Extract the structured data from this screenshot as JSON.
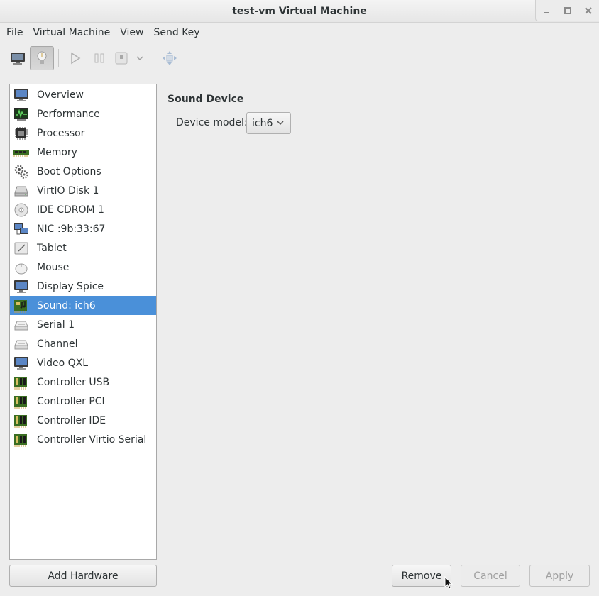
{
  "window": {
    "title": "test-vm Virtual Machine",
    "controls": [
      "minimize-icon",
      "maximize-icon",
      "close-icon"
    ]
  },
  "menubar": {
    "items": [
      "File",
      "Virtual Machine",
      "View",
      "Send Key"
    ]
  },
  "toolbar": {
    "buttons": [
      {
        "name": "console-view",
        "icon": "monitor-icon",
        "active": false
      },
      {
        "name": "details-view",
        "icon": "lightbulb-icon",
        "active": true
      },
      {
        "name": "run",
        "icon": "play-icon",
        "enabled": false
      },
      {
        "name": "pause",
        "icon": "pause-icon",
        "enabled": false
      },
      {
        "name": "shutdown",
        "icon": "power-icon",
        "enabled": false
      },
      {
        "name": "shutdown-menu",
        "icon": "chevron-down-icon",
        "enabled": false
      },
      {
        "name": "fullscreen",
        "icon": "fullscreen-icon",
        "enabled": false
      }
    ]
  },
  "hardware_list": {
    "items": [
      {
        "label": "Overview",
        "icon": "monitor-icon"
      },
      {
        "label": "Performance",
        "icon": "performance-monitor-icon"
      },
      {
        "label": "Processor",
        "icon": "cpu-chip-icon"
      },
      {
        "label": "Memory",
        "icon": "memory-module-icon"
      },
      {
        "label": "Boot Options",
        "icon": "gears-icon"
      },
      {
        "label": "VirtIO Disk 1",
        "icon": "hard-disk-icon"
      },
      {
        "label": "IDE CDROM 1",
        "icon": "cdrom-icon"
      },
      {
        "label": "NIC :9b:33:67",
        "icon": "network-icon"
      },
      {
        "label": "Tablet",
        "icon": "tablet-icon"
      },
      {
        "label": "Mouse",
        "icon": "mouse-icon"
      },
      {
        "label": "Display Spice",
        "icon": "display-icon"
      },
      {
        "label": "Sound: ich6",
        "icon": "sound-card-icon",
        "selected": true
      },
      {
        "label": "Serial 1",
        "icon": "serial-port-icon"
      },
      {
        "label": "Channel",
        "icon": "channel-icon"
      },
      {
        "label": "Video QXL",
        "icon": "video-card-icon"
      },
      {
        "label": "Controller USB",
        "icon": "controller-card-icon"
      },
      {
        "label": "Controller PCI",
        "icon": "controller-card-icon"
      },
      {
        "label": "Controller IDE",
        "icon": "controller-card-icon"
      },
      {
        "label": "Controller Virtio Serial",
        "icon": "controller-card-icon"
      }
    ],
    "add_button": "Add Hardware"
  },
  "details": {
    "section_title": "Sound Device",
    "device_model_label": "Device model:",
    "device_model_value": "ich6"
  },
  "actions": {
    "remove": "Remove",
    "cancel": "Cancel",
    "apply": "Apply"
  },
  "colors": {
    "selection": "#4a90d9",
    "background": "#ededed"
  }
}
